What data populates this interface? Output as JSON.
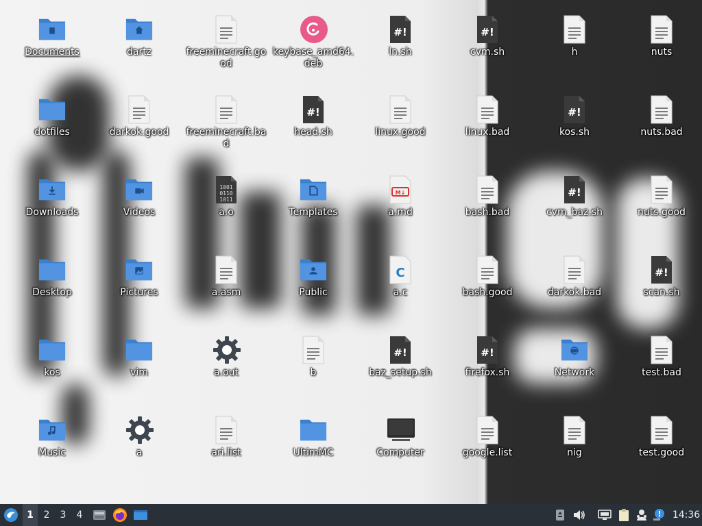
{
  "desktop": {
    "icons": [
      {
        "label": "Documents",
        "type": "folder",
        "emblem": "doc"
      },
      {
        "label": "dartz",
        "type": "folder",
        "emblem": "home"
      },
      {
        "label": "freeminecraft.good",
        "type": "text"
      },
      {
        "label": "keybase_amd64.deb",
        "type": "deb"
      },
      {
        "label": "ln.sh",
        "type": "script"
      },
      {
        "label": "cvm.sh",
        "type": "script"
      },
      {
        "label": "h",
        "type": "text"
      },
      {
        "label": "nuts",
        "type": "text"
      },
      {
        "label": "dotfiles",
        "type": "folder",
        "emblem": "none"
      },
      {
        "label": "darkok.good",
        "type": "text"
      },
      {
        "label": "freeminecraft.bad",
        "type": "text"
      },
      {
        "label": "head.sh",
        "type": "script"
      },
      {
        "label": "linux.good",
        "type": "text"
      },
      {
        "label": "linux.bad",
        "type": "text"
      },
      {
        "label": "kos.sh",
        "type": "script"
      },
      {
        "label": "nuts.bad",
        "type": "text"
      },
      {
        "label": "Downloads",
        "type": "folder",
        "emblem": "download"
      },
      {
        "label": "Videos",
        "type": "folder",
        "emblem": "video"
      },
      {
        "label": "a.o",
        "type": "binary"
      },
      {
        "label": "Templates",
        "type": "folder",
        "emblem": "template"
      },
      {
        "label": "a.md",
        "type": "markdown"
      },
      {
        "label": "bash.bad",
        "type": "text"
      },
      {
        "label": "cvm_baz.sh",
        "type": "script"
      },
      {
        "label": "nuts.good",
        "type": "text"
      },
      {
        "label": "Desktop",
        "type": "folder",
        "emblem": "none"
      },
      {
        "label": "Pictures",
        "type": "folder",
        "emblem": "picture"
      },
      {
        "label": "a.asm",
        "type": "text"
      },
      {
        "label": "Public",
        "type": "folder",
        "emblem": "user"
      },
      {
        "label": "a.c",
        "type": "csource"
      },
      {
        "label": "bash.good",
        "type": "text"
      },
      {
        "label": "darkok.bad",
        "type": "text"
      },
      {
        "label": "scan.sh",
        "type": "script"
      },
      {
        "label": "kos",
        "type": "folder",
        "emblem": "none"
      },
      {
        "label": "vim",
        "type": "folder",
        "emblem": "none"
      },
      {
        "label": "a.out",
        "type": "gear"
      },
      {
        "label": "b",
        "type": "text"
      },
      {
        "label": "baz_setup.sh",
        "type": "script"
      },
      {
        "label": "firefox.sh",
        "type": "script"
      },
      {
        "label": "Network",
        "type": "folder",
        "emblem": "globe"
      },
      {
        "label": "test.bad",
        "type": "text"
      },
      {
        "label": "Music",
        "type": "folder",
        "emblem": "music"
      },
      {
        "label": "a",
        "type": "gear"
      },
      {
        "label": "ari.list",
        "type": "text"
      },
      {
        "label": "UltimMC",
        "type": "folder",
        "emblem": "none"
      },
      {
        "label": "Computer",
        "type": "computer"
      },
      {
        "label": "google.list",
        "type": "text"
      },
      {
        "label": "nig",
        "type": "text"
      },
      {
        "label": "test.good",
        "type": "text"
      }
    ]
  },
  "taskbar": {
    "start_icon": "lxqt-logo-icon",
    "workspaces": [
      "1",
      "2",
      "3",
      "4"
    ],
    "active_workspace": "1",
    "launchers": [
      "file-manager-icon",
      "firefox-icon",
      "window-icon"
    ],
    "tray": [
      "removable-drive-icon",
      "volume-icon",
      "network-icon",
      "clipboard-icon",
      "update-notifier-icon",
      "info-icon"
    ],
    "clock": "14:36"
  },
  "colors": {
    "folder": "#5294e2",
    "folder_dark": "#3b7fcf",
    "script_bg": "#3a3a3a",
    "taskbar_bg": "#2a3038",
    "deb": "#e85a8a"
  }
}
